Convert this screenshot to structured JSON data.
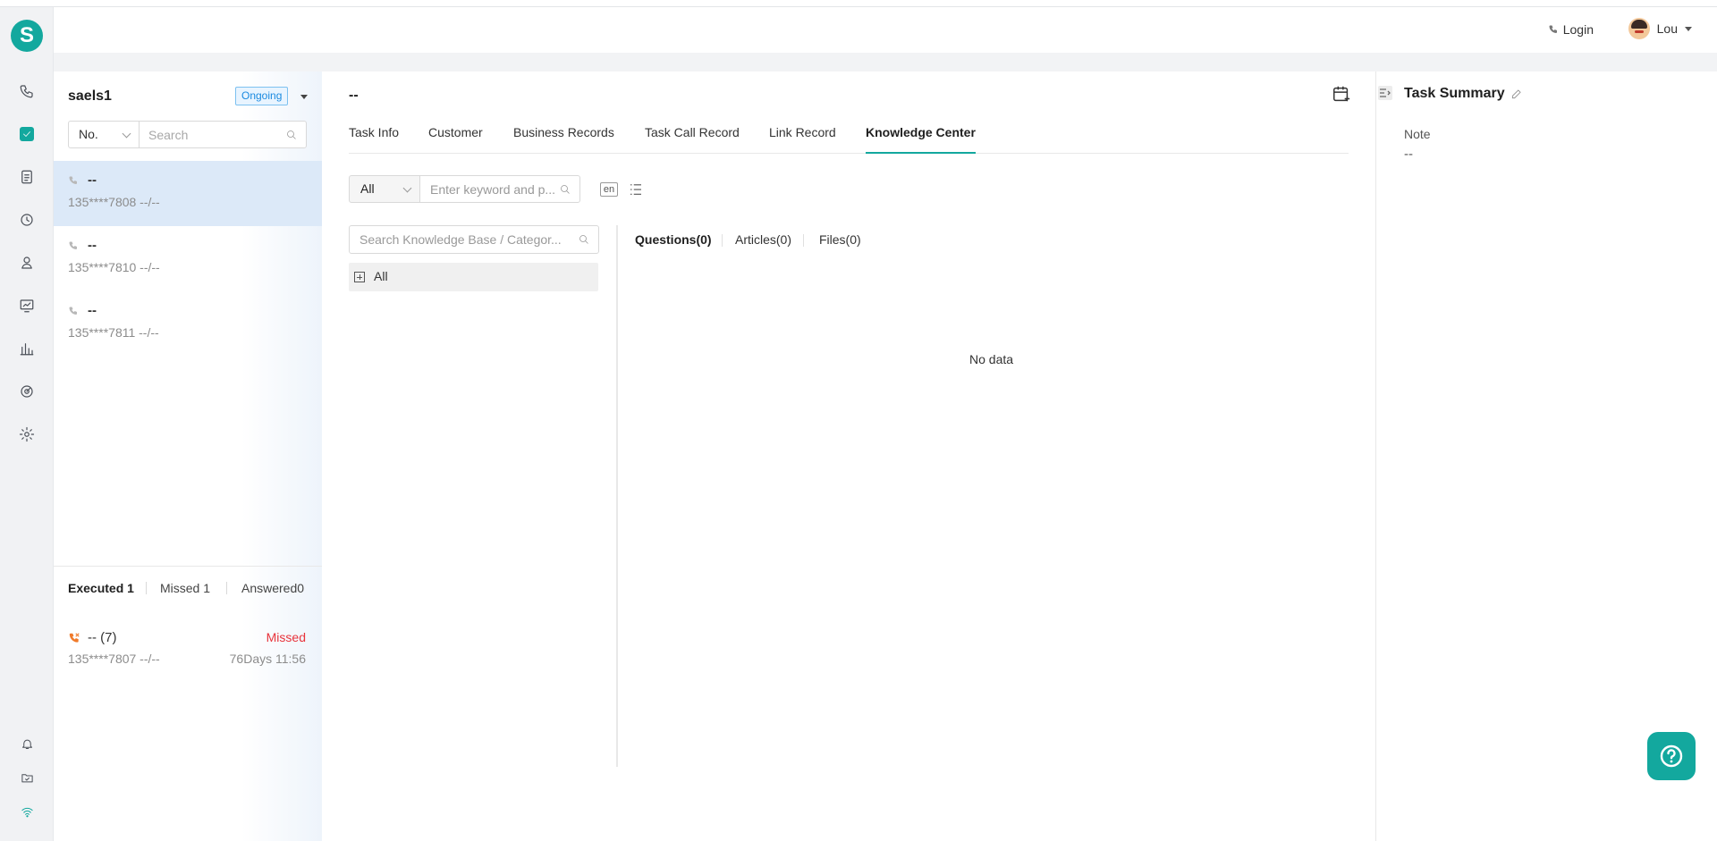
{
  "header": {
    "login_label": "Login",
    "user_name": "Lou"
  },
  "rail": {
    "logo_letter": "S",
    "icons": [
      "phone-icon",
      "task-icon",
      "document-icon",
      "clock-icon",
      "contacts-icon",
      "monitor-icon",
      "bar-chart-icon",
      "radar-icon",
      "settings-icon",
      "bell-icon",
      "folder-icon",
      "wifi-icon"
    ],
    "accent": "#13a89e"
  },
  "contacts": {
    "title": "saels1",
    "status_badge": "Ongoing",
    "sort_select": "No.",
    "search_placeholder": "Search",
    "items": [
      {
        "name": "--",
        "number": "135****7808 --/--"
      },
      {
        "name": "--",
        "number": "135****7810 --/--"
      },
      {
        "name": "--",
        "number": "135****7811 --/--"
      }
    ],
    "footer_tabs": [
      "Executed 1",
      "Missed 1",
      "Answered0"
    ],
    "missed_call": {
      "name": "-- (7)",
      "status": "Missed",
      "number": "135****7807 --/--",
      "time": "76Days 11:56"
    }
  },
  "main": {
    "title": "--",
    "tabs": [
      "Task Info",
      "Customer",
      "Business Records",
      "Task Call Record",
      "Link Record",
      "Knowledge Center"
    ],
    "active_tab": "Knowledge Center",
    "filter_select": "All",
    "keyword_placeholder": "Enter keyword and p...",
    "lang_badge": "en",
    "kb_search_placeholder": "Search Knowledge Base / Categor...",
    "tree_root": "All",
    "result_tabs": [
      "Questions(0)",
      "Articles(0)",
      "Files(0)"
    ],
    "empty_text": "No data"
  },
  "summary": {
    "title": "Task Summary",
    "note_label": "Note",
    "note_value": "--"
  }
}
